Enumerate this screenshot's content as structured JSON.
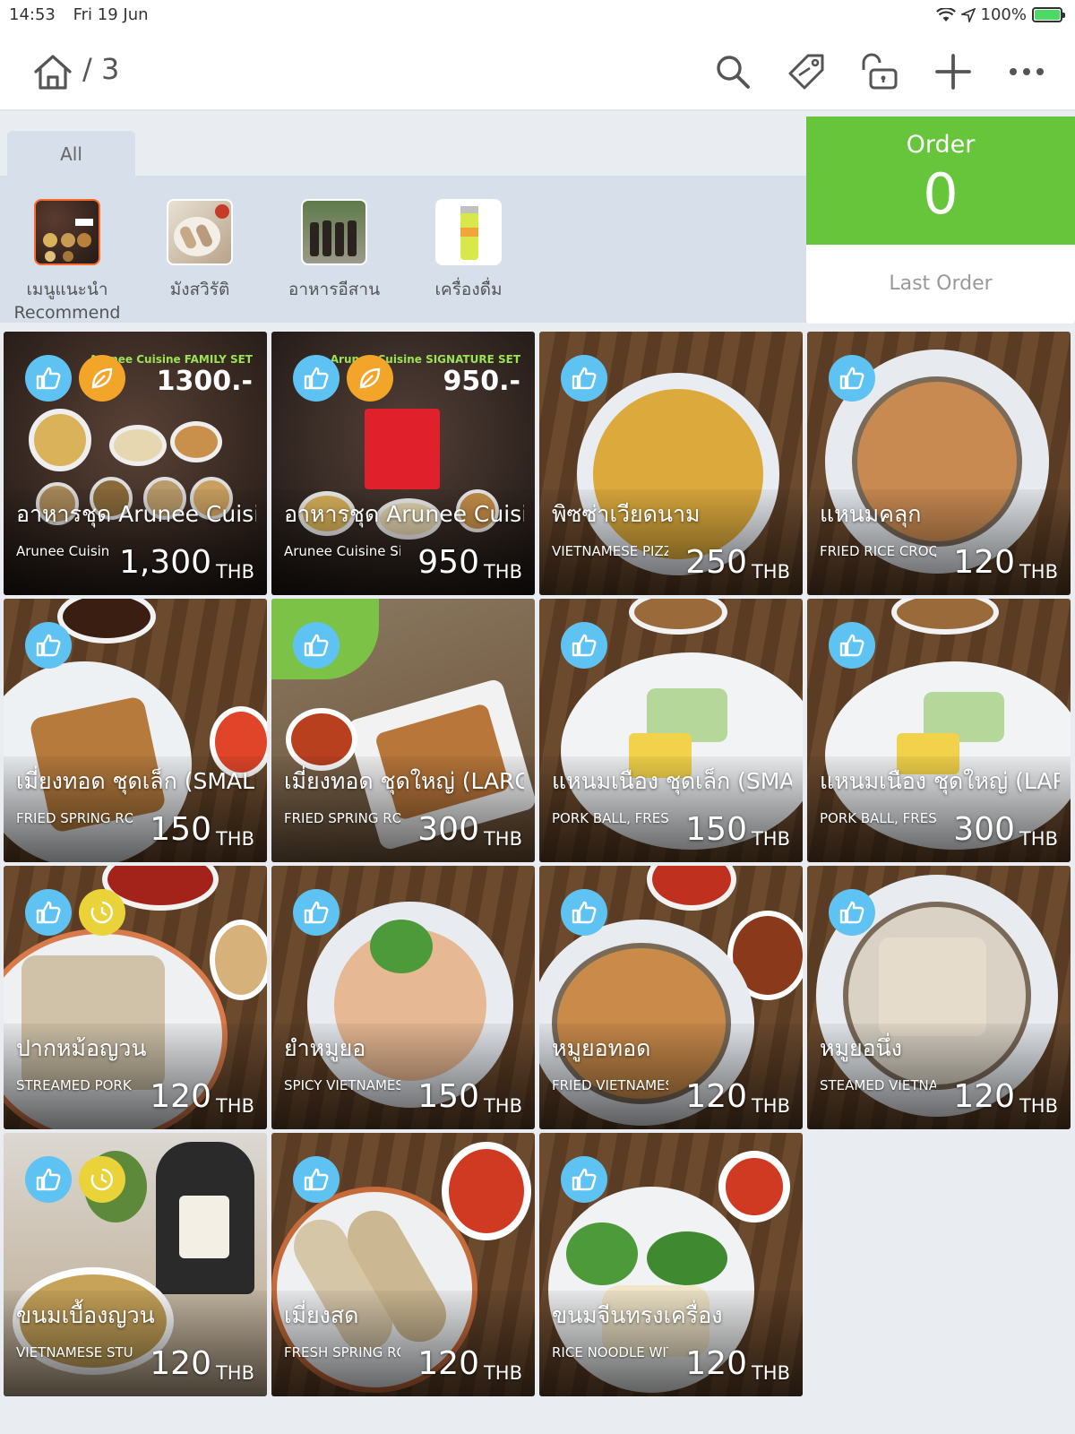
{
  "status_bar": {
    "time": "14:53",
    "date": "Fri 19 Jun",
    "battery": "100%"
  },
  "header": {
    "breadcrumb": "/ 3"
  },
  "nav_icons": [
    "search-icon",
    "tag-icon",
    "lock-icon",
    "plus-icon",
    "more-icon"
  ],
  "category_tab": "All",
  "categories": [
    {
      "label_th": "เมนูแนะนำ",
      "label_en": "Recommend",
      "active": true
    },
    {
      "label_th": "มังสวิรัติ",
      "label_en": ""
    },
    {
      "label_th": "อาหารอีสาน",
      "label_en": ""
    },
    {
      "label_th": "เครื่องดื่ม",
      "label_en": ""
    }
  ],
  "order": {
    "label": "Order",
    "count": "0",
    "last_order": "Last Order"
  },
  "currency": "THB",
  "poster": [
    {
      "head": "Arunee Cuisine FAMILY SET",
      "price": "1300.-"
    },
    {
      "head": "Arunee Cuisine SIGNATURE SET",
      "price": "950.-"
    }
  ],
  "colors": {
    "order_green": "#66c53a",
    "like_badge": "#5ec3f2",
    "leaf_badge": "#f3a52a",
    "clock_badge": "#e9d339",
    "active_category": "#ff6a2c"
  },
  "products": [
    {
      "name": "อาหารชุด Arunee Cuisine Fa",
      "sub": "Arunee Cuisin",
      "price": "1,300",
      "badges": [
        "like",
        "leaf"
      ]
    },
    {
      "name": "อาหารชุด Arunee Cuisine Sig",
      "sub": "Arunee Cuisine Si",
      "price": "950",
      "badges": [
        "like",
        "leaf"
      ]
    },
    {
      "name": "พิซซ่าเวียดนาม",
      "sub": "VIETNAMESE PIZZ",
      "price": "250",
      "badges": [
        "like"
      ]
    },
    {
      "name": "แหนมคลุก",
      "sub": "FRIED RICE CROQU",
      "price": "120",
      "badges": [
        "like"
      ]
    },
    {
      "name": "เมี่ยงทอด ชุดเล็ก (SMALL)",
      "sub": "FRIED SPRING ROI",
      "price": "150",
      "badges": [
        "like"
      ]
    },
    {
      "name": "เมี่ยงทอด ชุดใหญ่ (LARGE)",
      "sub": "FRIED SPRING RO",
      "price": "300",
      "badges": [
        "like"
      ]
    },
    {
      "name": "แหนมเนือง ชุดเล็ก (SMALL)",
      "sub": "PORK BALL, FRESI",
      "price": "150",
      "badges": [
        "like"
      ]
    },
    {
      "name": "แหนมเนือง ชุดใหญ่ (LARGE)",
      "sub": "PORK BALL, FRES",
      "price": "300",
      "badges": [
        "like"
      ]
    },
    {
      "name": "ปากหม้อญวน",
      "sub": "STREAMED PORK",
      "price": "120",
      "badges": [
        "like",
        "clock"
      ]
    },
    {
      "name": "ยำหมูยอ",
      "sub": "SPICY VIETNAMES",
      "price": "150",
      "badges": [
        "like"
      ]
    },
    {
      "name": "หมูยอทอด",
      "sub": "FRIED VIETNAMES",
      "price": "120",
      "badges": [
        "like"
      ]
    },
    {
      "name": "หมูยอนึ่ง",
      "sub": "STEAMED VIETNAI",
      "price": "120",
      "badges": [
        "like"
      ]
    },
    {
      "name": "ขนมเบื้องญวน",
      "sub": "VIETNAMESE STUI",
      "price": "120",
      "badges": [
        "like",
        "clock"
      ]
    },
    {
      "name": "เมี่ยงสด",
      "sub": "FRESH SPRING RO",
      "price": "120",
      "badges": [
        "like"
      ]
    },
    {
      "name": "ขนมจีนทรงเครื่อง",
      "sub": "RICE NOODLE WIT",
      "price": "120",
      "badges": [
        "like"
      ]
    }
  ]
}
